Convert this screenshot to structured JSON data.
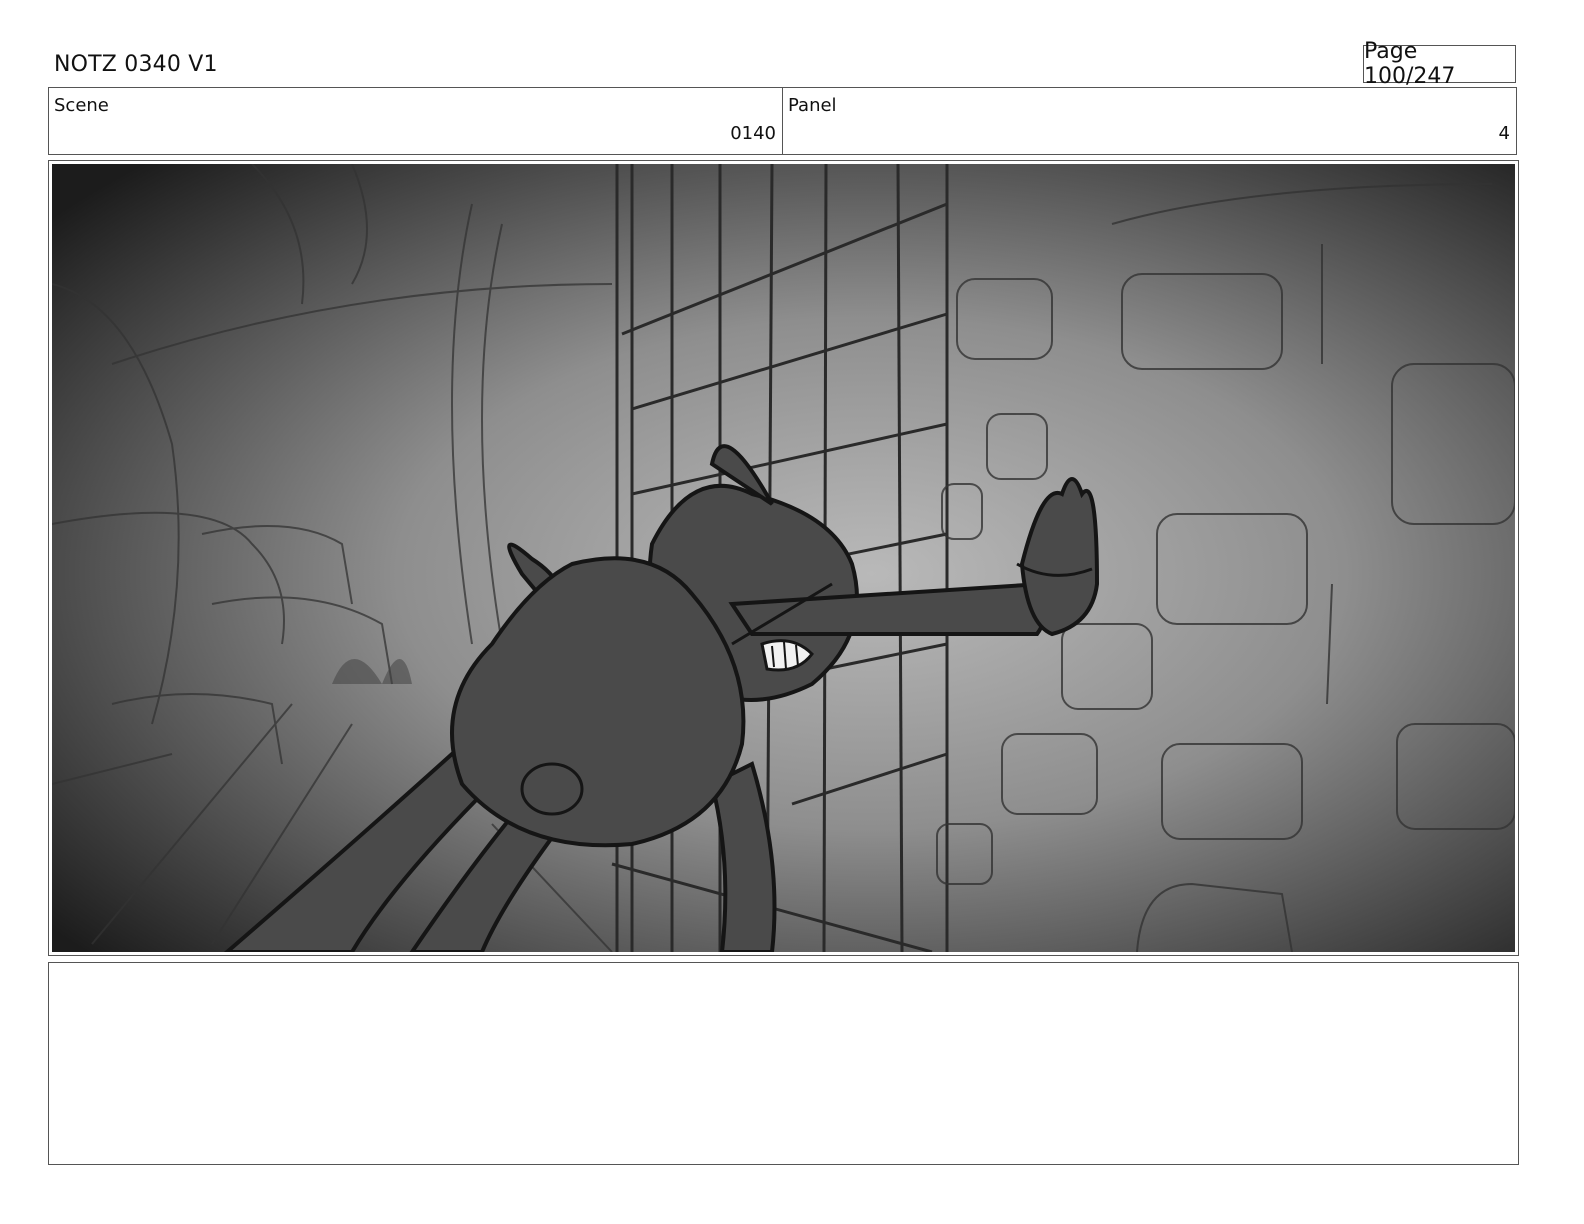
{
  "header": {
    "title": "NOTZ 0340 V1",
    "page": "Page 100/247"
  },
  "scene": {
    "label": "Scene",
    "value": "0140"
  },
  "panel": {
    "label": "Panel",
    "value": "4"
  },
  "artwork": {
    "style": "grayscale rough storyboard sketch",
    "subject": "cartoon creature pressing its hand against a barred window beside a stone wall"
  },
  "notes": {
    "text": ""
  }
}
